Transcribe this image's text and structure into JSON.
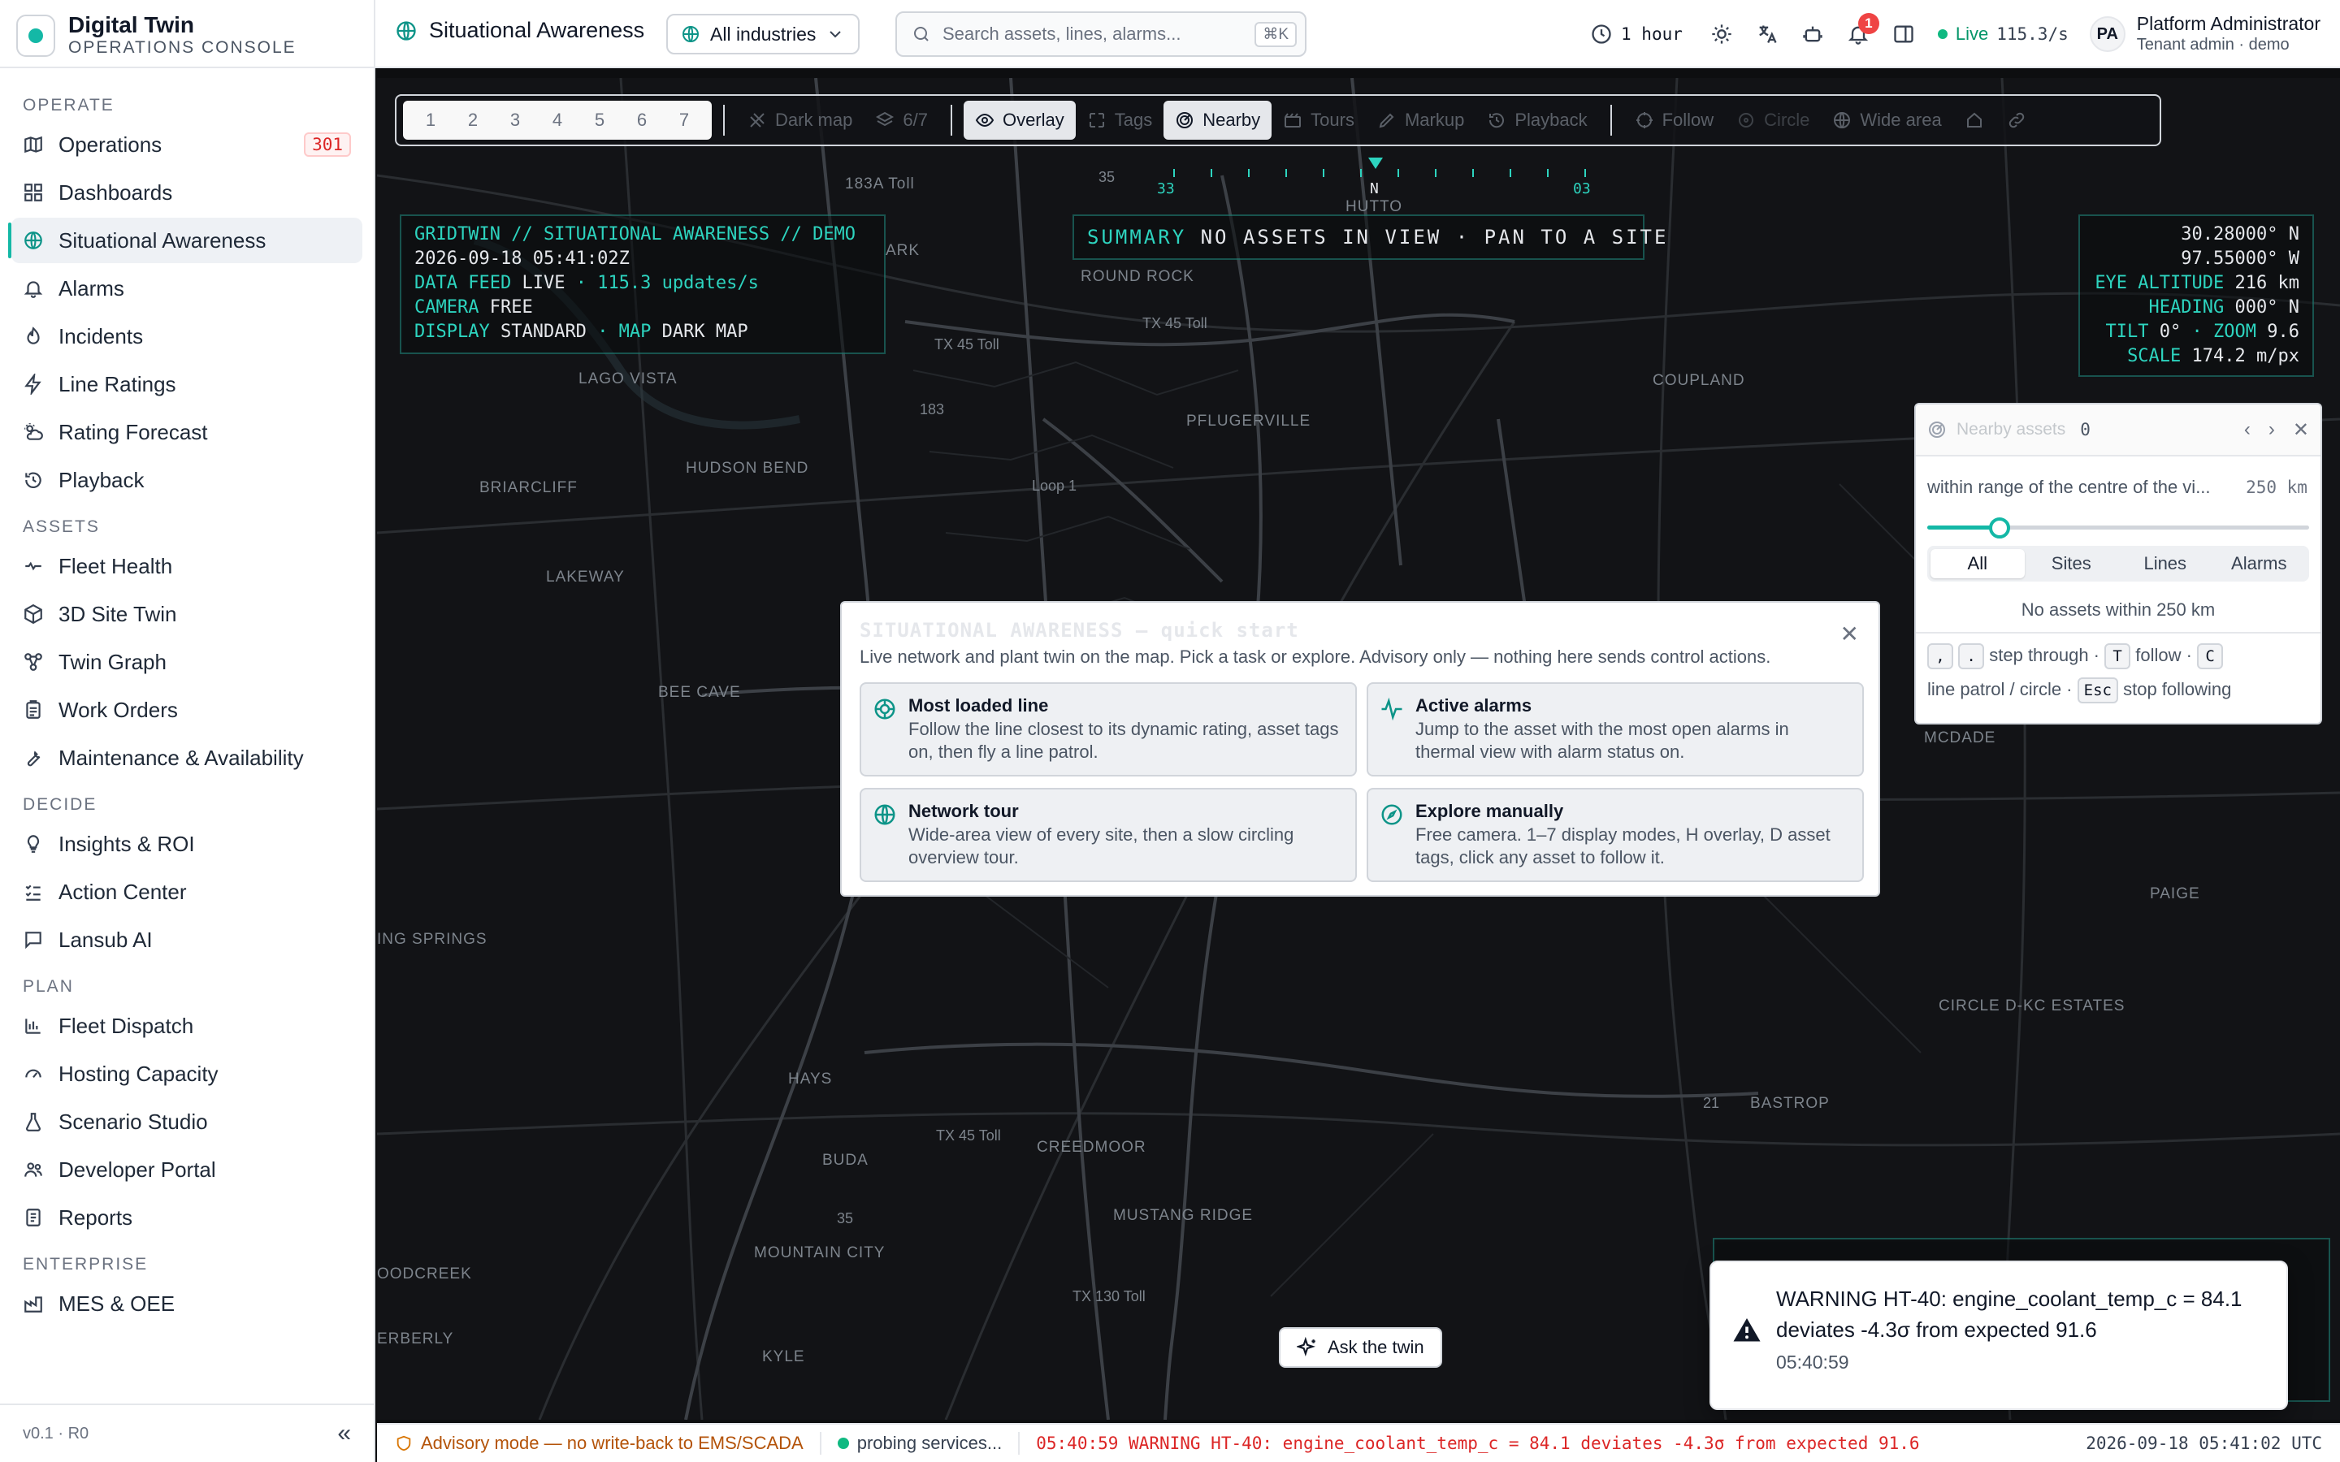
{
  "brand": {
    "title": "Digital Twin",
    "subtitle": "OPERATIONS CONSOLE"
  },
  "sidebar": {
    "sections": [
      {
        "label": "OPERATE",
        "items": [
          {
            "label": "Operations",
            "icon": "map-icon",
            "badge": "301"
          },
          {
            "label": "Dashboards",
            "icon": "grid-icon"
          },
          {
            "label": "Situational Awareness",
            "icon": "globe-icon",
            "active": true
          },
          {
            "label": "Alarms",
            "icon": "bell-icon"
          },
          {
            "label": "Incidents",
            "icon": "flame-icon"
          },
          {
            "label": "Line Ratings",
            "icon": "bolt-icon"
          },
          {
            "label": "Rating Forecast",
            "icon": "cloud-sun-icon"
          },
          {
            "label": "Playback",
            "icon": "history-icon"
          }
        ]
      },
      {
        "label": "ASSETS",
        "items": [
          {
            "label": "Fleet Health",
            "icon": "heart-pulse-icon"
          },
          {
            "label": "3D Site Twin",
            "icon": "cube-icon"
          },
          {
            "label": "Twin Graph",
            "icon": "nodes-icon"
          },
          {
            "label": "Work Orders",
            "icon": "clipboard-icon"
          },
          {
            "label": "Maintenance & Availability",
            "icon": "wrench-icon"
          }
        ]
      },
      {
        "label": "DECIDE",
        "items": [
          {
            "label": "Insights & ROI",
            "icon": "lightbulb-icon"
          },
          {
            "label": "Action Center",
            "icon": "checklist-icon"
          },
          {
            "label": "Lansub AI",
            "icon": "chat-icon"
          }
        ]
      },
      {
        "label": "PLAN",
        "items": [
          {
            "label": "Fleet Dispatch",
            "icon": "bar-chart-icon"
          },
          {
            "label": "Hosting Capacity",
            "icon": "gauge-icon"
          },
          {
            "label": "Scenario Studio",
            "icon": "flask-icon"
          },
          {
            "label": "Developer Portal",
            "icon": "users-icon"
          },
          {
            "label": "Reports",
            "icon": "report-icon"
          }
        ]
      },
      {
        "label": "ENTERPRISE",
        "items": [
          {
            "label": "MES & OEE",
            "icon": "factory-icon"
          }
        ]
      }
    ],
    "version": "v0.1 · R0",
    "collapse_label": "«"
  },
  "topbar": {
    "page_title": "Situational Awareness",
    "industry": "All industries",
    "search_placeholder": "Search assets, lines, alarms...",
    "search_shortcut": "⌘K",
    "time_range": "1 hour",
    "notification_count": "1",
    "live_label": "Live",
    "live_rate": "115.3/s",
    "user_initials": "PA",
    "user_name": "Platform Administrator",
    "user_role": "Tenant admin · demo"
  },
  "toolbar": {
    "modes": [
      "1",
      "2",
      "3",
      "4",
      "5",
      "6",
      "7"
    ],
    "dark_map": "Dark map",
    "layers": "6/7",
    "overlay": "Overlay",
    "tags": "Tags",
    "nearby": "Nearby",
    "tours": "Tours",
    "markup": "Markup",
    "playback": "Playback",
    "follow": "Follow",
    "circle": "Circle",
    "wide_area": "Wide area"
  },
  "compass": {
    "left": "33",
    "center": "N",
    "right": "03"
  },
  "hud_left": {
    "line1": "GRIDTWIN // SITUATIONAL AWARENESS // DEMO",
    "line2": "2026-09-18 05:41:02Z",
    "feed_label": "DATA FEED",
    "feed_value": "LIVE",
    "feed_rate": "· 115.3 updates/s",
    "camera_label": "CAMERA",
    "camera_value": "FREE",
    "display_label": "DISPLAY",
    "display_value": "STANDARD",
    "map_label": "· MAP",
    "map_value": "DARK MAP"
  },
  "hud_summary": {
    "label": "SUMMARY",
    "value": "NO ASSETS IN VIEW · PAN TO A SITE"
  },
  "hud_right": {
    "lat": "30.28000° N",
    "lon": "97.55000° W",
    "alt_label": "EYE ALTITUDE",
    "alt_value": "216 km",
    "heading_label": "HEADING",
    "heading_value": "000° N",
    "tilt_label": "TILT",
    "tilt_value": "0°",
    "zoom_label": "· ZOOM",
    "zoom_value": "9.6",
    "scale_label": "SCALE",
    "scale_value": "174.2 m/px"
  },
  "map_places": {
    "toll183a": "183A Toll",
    "round_rock": "ROUND ROCK",
    "hutto": "HUTTO",
    "tx45_1": "TX 45 Toll",
    "tx45_2": "TX 45 Toll",
    "lago_vista": "LAGO VISTA",
    "coupland": "COUPLAND",
    "pflugerville": "PFLUGERVILLE",
    "r183": "183",
    "briarcliff": "BRIARCLIFF",
    "hudson_bend": "HUDSON BEND",
    "loop1": "Loop 1",
    "lakeway": "LAKEWAY",
    "bee_cave": "BEE CAVE",
    "mcdade": "MCDADE",
    "paige": "PAIGE",
    "ing_springs": "ING SPRINGS",
    "circle_dkc": "CIRCLE D-KC ESTATES",
    "hays": "HAYS",
    "r21": "21",
    "bastrop": "BASTROP",
    "buda": "BUDA",
    "tx45_3": "TX 45 Toll",
    "creedmoor": "CREEDMOOR",
    "r35_1": "35",
    "r35_2": "35",
    "mustang_ridge": "MUSTANG RIDGE",
    "mountain_city": "MOUNTAIN CITY",
    "oodcreek": "OODCREEK",
    "tx130": "TX 130 Toll",
    "erberly": "ERBERLY",
    "kyle": "KYLE",
    "ark": "ARK"
  },
  "nearby": {
    "title": "Nearby assets",
    "count": "0",
    "range_label": "within range of the centre of the vi...",
    "range_value": "250 km",
    "range_fraction": 0.19,
    "tabs": [
      "All",
      "Sites",
      "Lines",
      "Alarms"
    ],
    "active_tab": "All",
    "empty": "No assets within 250 km",
    "help_key1": ",",
    "help_key2": ".",
    "help_step": "step through ·",
    "help_key3": "T",
    "help_follow": "follow ·",
    "help_key4": "C",
    "help_patrol": "line patrol / circle ·",
    "help_key5": "Esc",
    "help_stop": "stop following"
  },
  "quickstart": {
    "title": "SITUATIONAL AWARENESS — quick start",
    "description": "Live network and plant twin on the map. Pick a task or explore. Advisory only — nothing here sends control actions.",
    "cards": [
      {
        "title": "Most loaded line",
        "desc": "Follow the line closest to its dynamic rating, asset tags on, then fly a line patrol.",
        "icon": "target-icon"
      },
      {
        "title": "Active alarms",
        "desc": "Jump to the asset with the most open alarms in thermal view with alarm status on.",
        "icon": "pulse-icon"
      },
      {
        "title": "Network tour",
        "desc": "Wide-area view of every site, then a slow circling overview tour.",
        "icon": "globe-icon"
      },
      {
        "title": "Explore manually",
        "desc": "Free camera. 1–7 display modes, H overlay, D asset tags, click any asset to follow it.",
        "icon": "compass-icon"
      }
    ]
  },
  "ask": {
    "label": "Ask the twin"
  },
  "toast": {
    "message": "WARNING HT-40: engine_coolant_temp_c = 84.1 deviates -4.3σ from expected 91.6",
    "time": "05:40:59"
  },
  "statusbar": {
    "advisory": "Advisory mode — no write-back to EMS/SCADA",
    "probing": "probing services...",
    "alert": "05:40:59 WARNING HT-40: engine_coolant_temp_c = 84.1 deviates -4.3σ from expected 91.6",
    "time": "2026-09-18 05:41:02 UTC"
  },
  "colors": {
    "accent": "#14b8a6",
    "hud": "#2dd4bf",
    "alert": "#dc2626",
    "advisory": "#b45309"
  }
}
